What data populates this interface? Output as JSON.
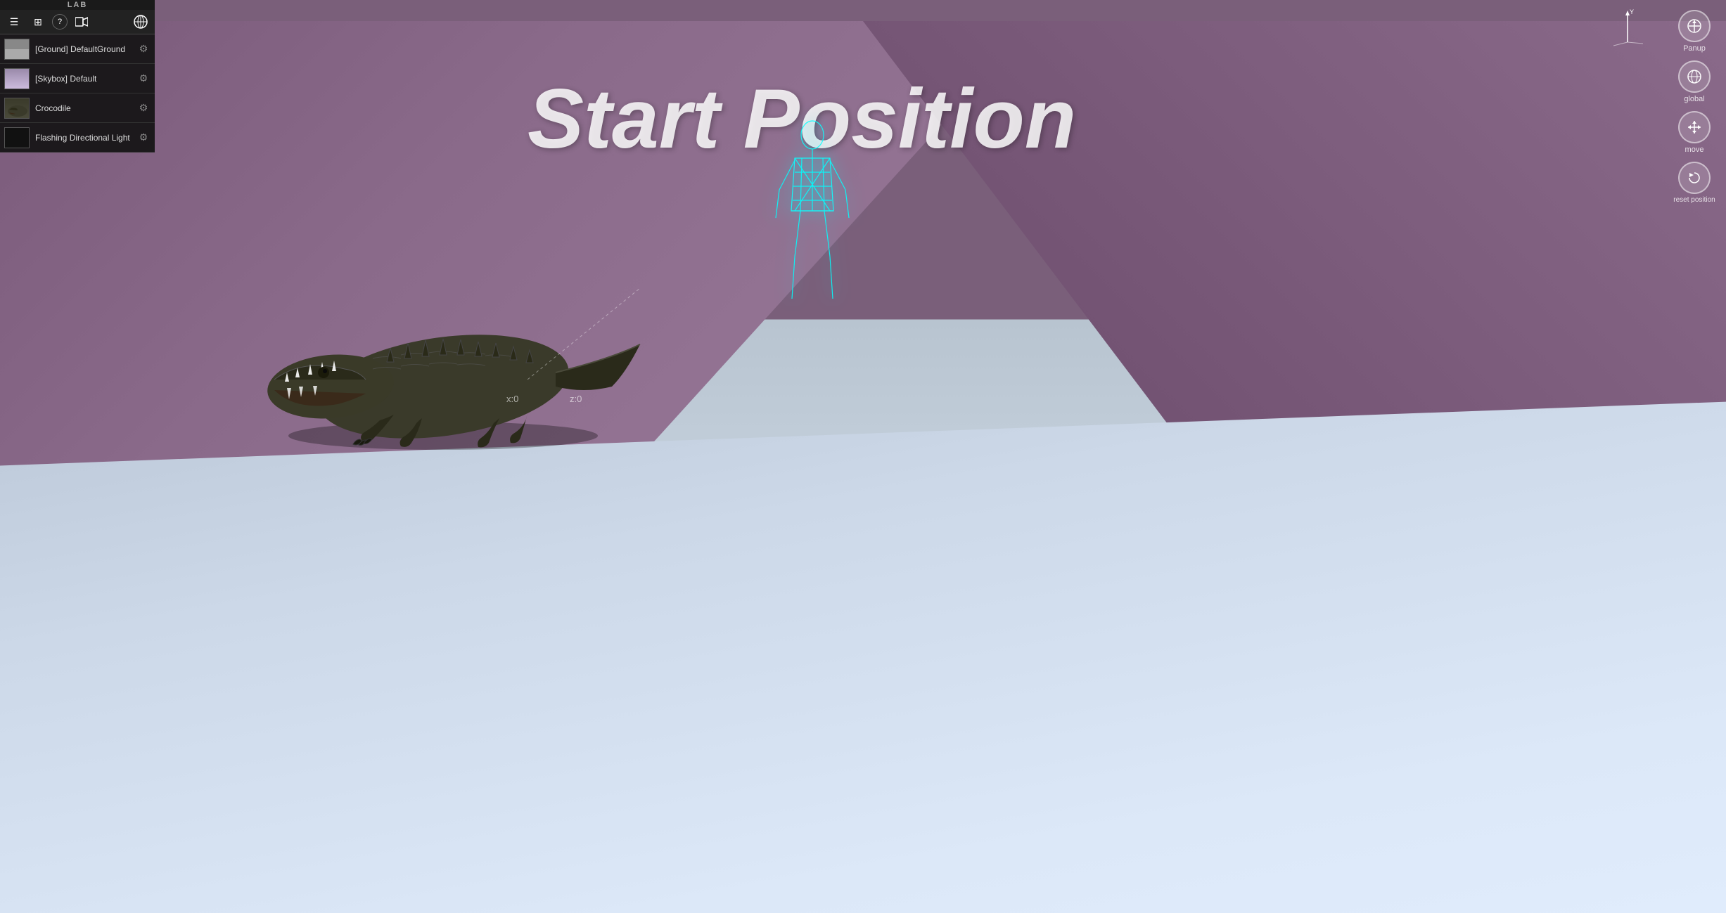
{
  "app": {
    "title": "LAB"
  },
  "toolbar": {
    "buttons": [
      {
        "id": "menu",
        "icon": "☰",
        "label": "menu"
      },
      {
        "id": "display",
        "icon": "⊞",
        "label": "display"
      },
      {
        "id": "help",
        "icon": "?",
        "label": "help"
      },
      {
        "id": "video",
        "icon": "▶",
        "label": "video"
      },
      {
        "id": "globe",
        "icon": "🌐",
        "label": "globe"
      }
    ]
  },
  "scene_list": {
    "items": [
      {
        "id": "ground",
        "label": "[Ground] DefaultGround",
        "thumb_type": "ground"
      },
      {
        "id": "skybox",
        "label": "[Skybox] Default",
        "thumb_type": "sky"
      },
      {
        "id": "crocodile",
        "label": "Crocodile",
        "thumb_type": "croc"
      },
      {
        "id": "flashing_light",
        "label": "Flashing Directional Light",
        "thumb_type": "light"
      }
    ]
  },
  "viewport": {
    "start_position_text": "Start Position",
    "coord_x_label": "x:0",
    "coord_z_label": "z:0"
  },
  "right_controls": [
    {
      "id": "pan",
      "label": "Panup",
      "icon": "⊕"
    },
    {
      "id": "global",
      "label": "global",
      "icon": "🌐"
    },
    {
      "id": "move",
      "label": "move",
      "icon": "✛"
    },
    {
      "id": "reset",
      "label": "reset position",
      "icon": "↺"
    }
  ],
  "axis_gizmo": {
    "y_label": "Y"
  }
}
